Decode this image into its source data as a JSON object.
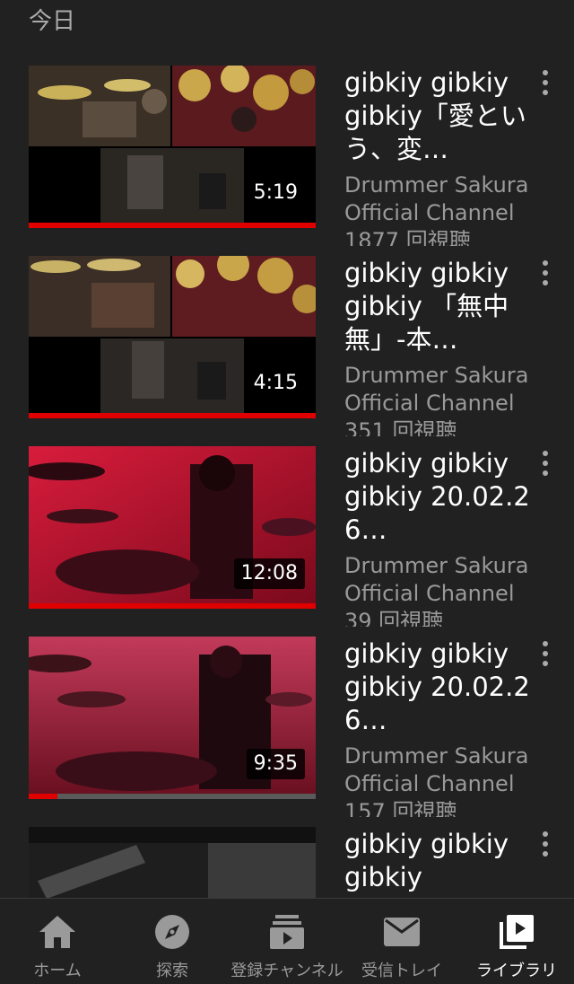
{
  "section": {
    "header": "今日"
  },
  "videos": [
    {
      "title": "gibkiy gibkiy gibkiy「愛という、変…",
      "channel": "Drummer Sakura Official Channel",
      "views": "1877 回視聴",
      "duration": "5:19",
      "progress": 1.0
    },
    {
      "title": "gibkiy gibkiy gibkiy 「無中無」-本…",
      "channel": "Drummer Sakura Official Channel",
      "views": "351 回視聴",
      "duration": "4:15",
      "progress": 1.0
    },
    {
      "title": "gibkiy gibkiy gibkiy 20.02.26…",
      "channel": "Drummer Sakura Official Channel",
      "views": "39 回視聴",
      "duration": "12:08",
      "progress": 1.0
    },
    {
      "title": "gibkiy gibkiy gibkiy 20.02.26…",
      "channel": "Drummer Sakura Official Channel",
      "views": "157 回視聴",
      "duration": "9:35",
      "progress": 0.1
    },
    {
      "title": "gibkiy gibkiy gibkiy",
      "channel": "",
      "views": "",
      "duration": "",
      "progress": 0
    }
  ],
  "nav": {
    "items": [
      {
        "label": "ホーム",
        "icon": "home-icon",
        "active": false
      },
      {
        "label": "探索",
        "icon": "explore-icon",
        "active": false
      },
      {
        "label": "登録チャンネル",
        "icon": "subscriptions-icon",
        "active": false
      },
      {
        "label": "受信トレイ",
        "icon": "inbox-icon",
        "active": false
      },
      {
        "label": "ライブラリ",
        "icon": "library-icon",
        "active": true
      }
    ]
  },
  "colors": {
    "background": "#212121",
    "accent": "#e00000",
    "muted_text": "#9a9a9a"
  }
}
